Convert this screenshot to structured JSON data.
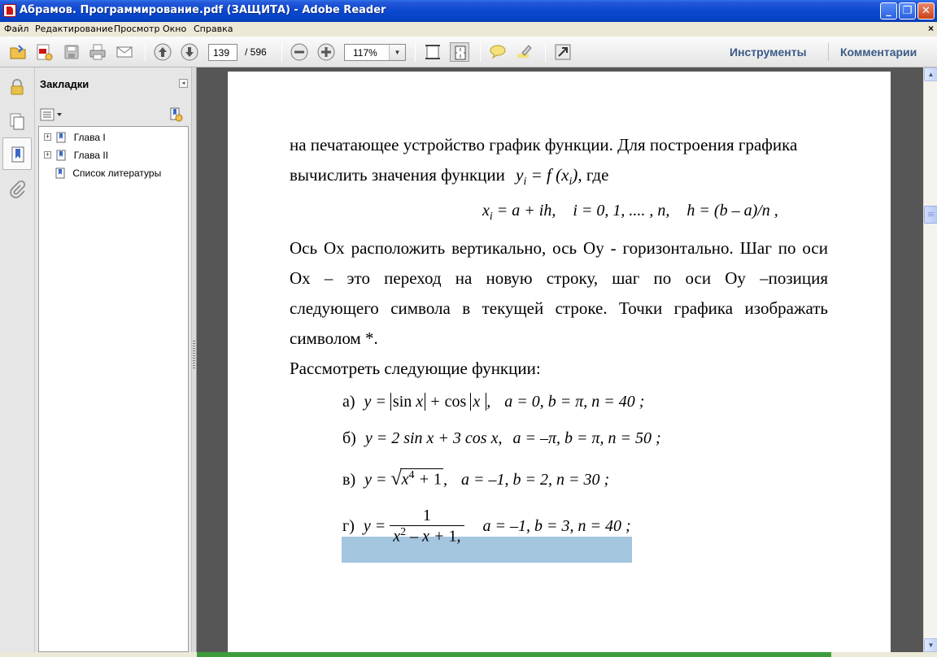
{
  "window": {
    "title": "Абрамов. Программирование.pdf (ЗАЩИТА) - Adobe Reader",
    "buttons": {
      "minimize": "_",
      "maximize": "❐",
      "close": "✕"
    }
  },
  "menu": {
    "items": [
      "Файл",
      "Редактирование",
      "Просмотр",
      "Окно",
      "Справка"
    ],
    "close_doc": "×"
  },
  "toolbar": {
    "current_page": "139",
    "total_pages": "/ 596",
    "zoom": "117%",
    "tools_label": "Инструменты",
    "comments_label": "Комментарии",
    "icons": [
      "open-icon",
      "create-pdf-icon",
      "save-icon",
      "print-icon",
      "email-icon",
      "previous-page-icon",
      "next-page-icon",
      "zoom-out-icon",
      "zoom-in-icon",
      "fit-width-icon",
      "fit-page-icon",
      "comment-icon",
      "highlight-icon",
      "full-screen-icon"
    ]
  },
  "sidebar": {
    "strip_icons": [
      "lock-icon",
      "pages-icon",
      "bookmark-icon",
      "attachment-icon"
    ],
    "active": "bookmark-icon",
    "bookmarks_title": "Закладки",
    "collapse_glyph": "◂",
    "bookmarks": [
      {
        "label": "Глава I",
        "expandable": true
      },
      {
        "label": "Глава II",
        "expandable": true
      },
      {
        "label": "Список литературы",
        "expandable": false
      }
    ],
    "expand_glyph": "+"
  },
  "document": {
    "para1_line1": "на печатающее устройство график функции. Для построения графика",
    "para1_line2_prefix": "вычислить значения функции",
    "para1_line2_suffix": ", где",
    "formula_xi": {
      "lhs": "x",
      "sub": "i",
      "rhs1": " = a + ih,",
      "rhs2": "i = 0, 1, .... , n,",
      "rhs3": "h = (b – a)/n ,"
    },
    "para2": [
      "Ось Ox расположить вертикально, ось Oy - горизонтально. Шаг по оси",
      "Ox – это переход на новую строку, шаг по оси Oy –позиция",
      "следующего символа в текущей строке. Точки графика изображать",
      "символом *."
    ],
    "para3": "Рассмотреть следующие функции:",
    "functions": [
      {
        "label": "а)",
        "params": "a = 0,   b = π,   n = 40 ;"
      },
      {
        "label": "б)",
        "expr": "y = 2 sin x + 3 cos x,",
        "params": "a = –π,   b = π,   n = 50 ;"
      },
      {
        "label": "в)",
        "params": "a = –1,   b = 2,   n = 30 ;",
        "highlighted": true
      },
      {
        "label": "г)",
        "params": "a = –1,   b = 3,   n = 40 ;"
      }
    ]
  },
  "colors": {
    "titlebar": "#0a48cf",
    "selection_highlight": "#a3c5de",
    "doc_background": "#565656"
  }
}
